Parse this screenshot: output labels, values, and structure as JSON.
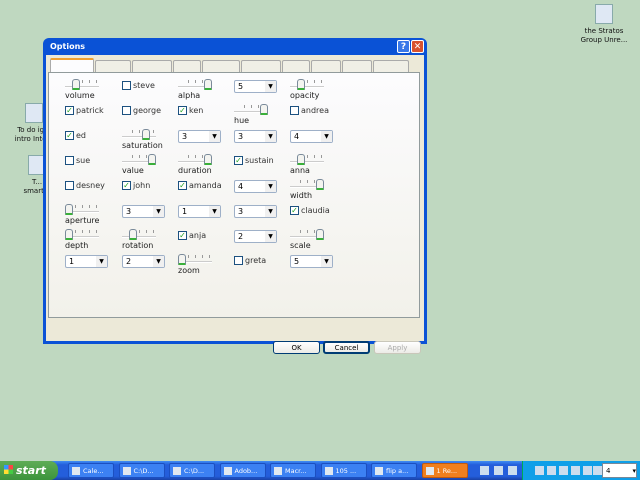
{
  "desktop": {
    "icons": [
      {
        "label": "the Stratos Group Unre..."
      },
      {
        "label": "To do ig... intro Inte..."
      },
      {
        "label": "T... smart..."
      }
    ]
  },
  "dialog": {
    "title": "Options",
    "tab_count": 10,
    "controls": [
      [
        {
          "type": "slider",
          "label": "volume",
          "value": 0.25
        },
        {
          "type": "checkbox",
          "label": "steve",
          "checked": false
        },
        {
          "type": "slider",
          "label": "alpha",
          "value": 1.0
        },
        {
          "type": "combo",
          "value": "5"
        },
        {
          "type": "slider",
          "label": "opacity",
          "value": 0.25
        }
      ],
      [
        {
          "type": "checkbox",
          "label": "patrick",
          "checked": true
        },
        {
          "type": "checkbox",
          "label": "george",
          "checked": false
        },
        {
          "type": "checkbox",
          "label": "ken",
          "checked": true
        },
        {
          "type": "slider",
          "label": "hue",
          "value": 1.0
        },
        {
          "type": "checkbox",
          "label": "andrea",
          "checked": false
        }
      ],
      [
        {
          "type": "checkbox",
          "label": "ed",
          "checked": true
        },
        {
          "type": "slider",
          "label": "saturation",
          "value": 0.75
        },
        {
          "type": "combo",
          "value": "3"
        },
        {
          "type": "combo",
          "value": "3"
        },
        {
          "type": "combo",
          "value": "4"
        }
      ],
      [
        {
          "type": "checkbox",
          "label": "sue",
          "checked": false
        },
        {
          "type": "slider",
          "label": "value",
          "value": 1.0
        },
        {
          "type": "slider",
          "label": "duration",
          "value": 1.0
        },
        {
          "type": "checkbox",
          "label": "sustain",
          "checked": true
        },
        {
          "type": "slider",
          "label": "anna",
          "value": 0.25
        }
      ],
      [
        {
          "type": "checkbox",
          "label": "desney",
          "checked": false
        },
        {
          "type": "checkbox",
          "label": "john",
          "checked": true
        },
        {
          "type": "checkbox",
          "label": "amanda",
          "checked": true
        },
        {
          "type": "combo",
          "value": "4"
        },
        {
          "type": "slider",
          "label": "width",
          "value": 1.0
        }
      ],
      [
        {
          "type": "slider",
          "label": "aperture",
          "value": 0
        },
        {
          "type": "combo",
          "value": "3"
        },
        {
          "type": "combo",
          "value": "1"
        },
        {
          "type": "combo",
          "value": "3"
        },
        {
          "type": "checkbox",
          "label": "claudia",
          "checked": true
        }
      ],
      [
        {
          "type": "slider",
          "label": "depth",
          "value": 0
        },
        {
          "type": "slider",
          "label": "rotation",
          "value": 0.25
        },
        {
          "type": "checkbox",
          "label": "anja",
          "checked": true
        },
        {
          "type": "combo",
          "value": "2"
        },
        {
          "type": "slider",
          "label": "scale",
          "value": 1.0
        }
      ],
      [
        {
          "type": "combo",
          "value": "1"
        },
        {
          "type": "combo",
          "value": "2"
        },
        {
          "type": "slider",
          "label": "zoom",
          "value": 0
        },
        {
          "type": "checkbox",
          "label": "greta",
          "checked": false
        },
        {
          "type": "combo",
          "value": "5"
        }
      ]
    ],
    "buttons": {
      "ok": "OK",
      "cancel": "Cancel",
      "apply": "Apply"
    }
  },
  "taskbar": {
    "start": "start",
    "tasks": [
      {
        "label": "Cale..."
      },
      {
        "label": "C:\\D..."
      },
      {
        "label": "C:\\D..."
      },
      {
        "label": "Adob..."
      },
      {
        "label": "Macr..."
      },
      {
        "label": "105 ..."
      },
      {
        "label": "flip a..."
      },
      {
        "label": "1 Re...",
        "active": true
      }
    ],
    "tray_combo": "4"
  }
}
